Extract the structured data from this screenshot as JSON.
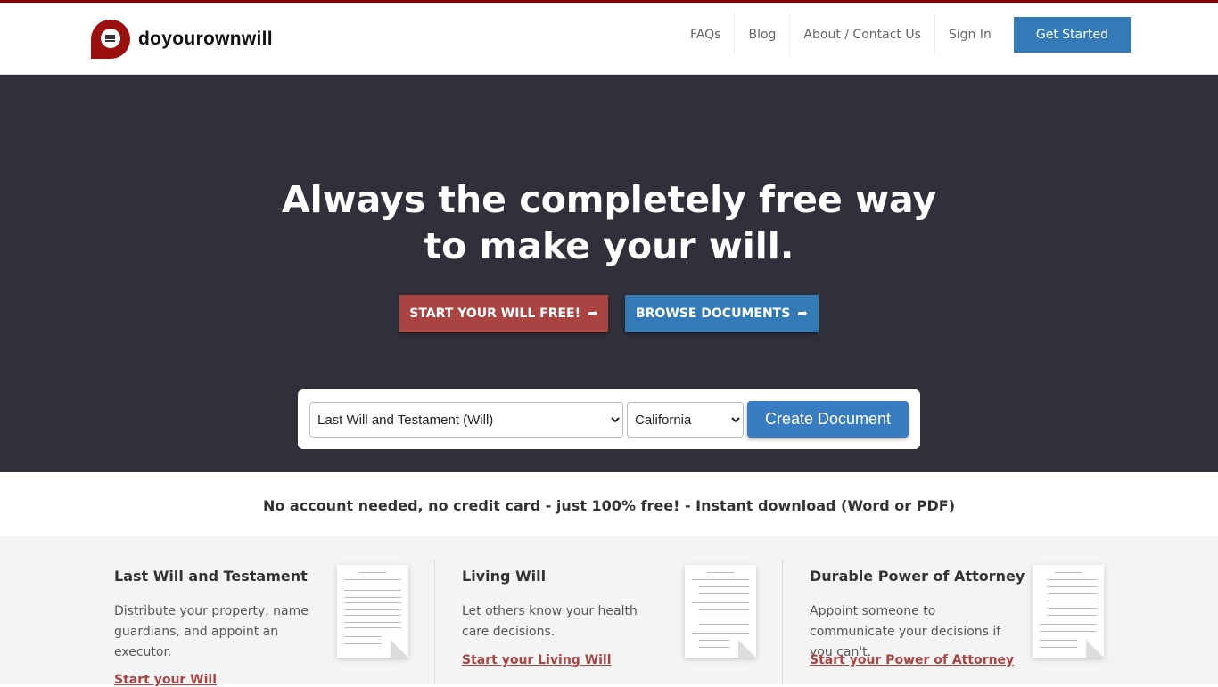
{
  "brand": {
    "name": "doyourownwill",
    "color": "#9c1010"
  },
  "nav": {
    "items": [
      "FAQs",
      "Blog",
      "About / Contact Us",
      "Sign In"
    ],
    "cta": "Get Started"
  },
  "hero": {
    "title_line1": "Always the completely free way",
    "title_line2": "to make your will.",
    "start_button": "START YOUR WILL FREE!",
    "browse_button": "BROWSE DOCUMENTS",
    "arrow_icon": "share-arrow-icon"
  },
  "form": {
    "document_type": "Last Will and Testament (Will)",
    "state": "California",
    "create_button": "Create Document"
  },
  "tagline": "No account needed, no credit card - just 100% free! - Instant download (Word or PDF)",
  "cards": [
    {
      "title": "Last Will and Testament",
      "desc": "Distribute your property, name guardians, and appoint an executor.",
      "link": "Start your Will"
    },
    {
      "title": "Living Will",
      "desc": "Let others know your health care decisions.",
      "link": "Start your Living Will"
    },
    {
      "title": "Durable Power of Attorney",
      "desc": "Appoint someone to communicate your decisions if you can't.",
      "link": "Start your Power of Attorney"
    }
  ]
}
